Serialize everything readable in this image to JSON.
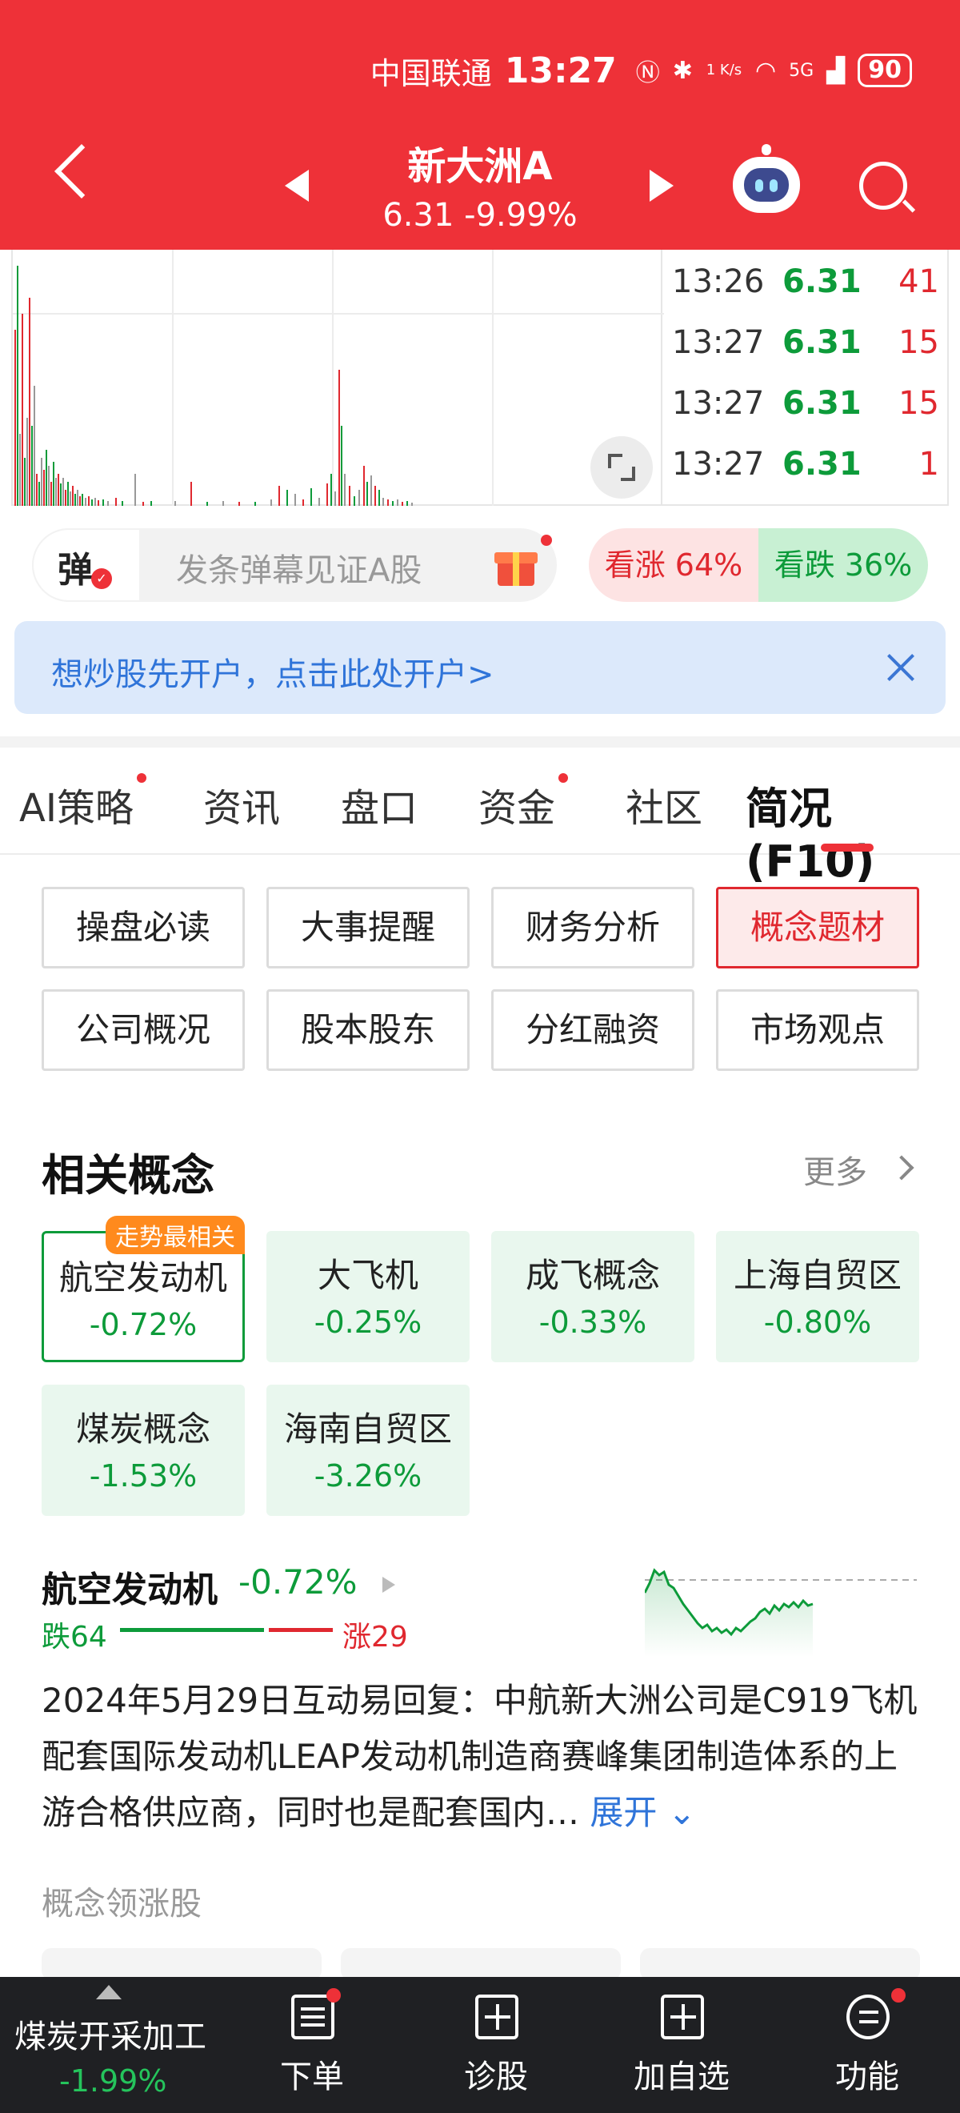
{
  "status_bar": {
    "carrier": "中国联通",
    "time": "13:27",
    "net_speed": "1 K/s",
    "network": "5G",
    "battery": "90"
  },
  "header": {
    "stock_name": "新大洲A",
    "price_line": "6.31 -9.99%",
    "bg_color": "#ee3138"
  },
  "chart": {
    "type": "volume-bars",
    "up_color": "#e0282f",
    "down_color": "#0d9b3a"
  },
  "ticks": [
    {
      "time": "13:26",
      "price": "6.31",
      "vol": "41"
    },
    {
      "time": "13:27",
      "price": "6.31",
      "vol": "15"
    },
    {
      "time": "13:27",
      "price": "6.31",
      "vol": "15"
    },
    {
      "time": "13:27",
      "price": "6.31",
      "vol": "1"
    }
  ],
  "danmaku": {
    "badge": "弹",
    "placeholder": "发条弹幕见证A股"
  },
  "sentiment": {
    "bull": "看涨 64%",
    "bear": "看跌 36%",
    "bull_pct": 64,
    "bear_pct": 36
  },
  "banner": {
    "text": "想炒股先开户，点击此处开户>"
  },
  "tabs": [
    {
      "label": "AI策略",
      "dot": true
    },
    {
      "label": "资讯",
      "dot": false
    },
    {
      "label": "盘口",
      "dot": false
    },
    {
      "label": "资金",
      "dot": true
    },
    {
      "label": "社区",
      "dot": false
    },
    {
      "label": "简况(F10)",
      "dot": false,
      "active": true
    }
  ],
  "f10": [
    {
      "label": "操盘必读"
    },
    {
      "label": "大事提醒"
    },
    {
      "label": "财务分析"
    },
    {
      "label": "概念题材",
      "active": true
    },
    {
      "label": "公司概况"
    },
    {
      "label": "股本股东"
    },
    {
      "label": "分红融资"
    },
    {
      "label": "市场观点"
    }
  ],
  "concepts_section": {
    "title": "相关概念",
    "more": "更多",
    "badge": "走势最相关",
    "items": [
      {
        "name": "航空发动机",
        "pct": "-0.72%"
      },
      {
        "name": "大飞机",
        "pct": "-0.25%"
      },
      {
        "name": "成飞概念",
        "pct": "-0.33%"
      },
      {
        "name": "上海自贸区",
        "pct": "-0.80%"
      },
      {
        "name": "煤炭概念",
        "pct": "-1.53%"
      },
      {
        "name": "海南自贸区",
        "pct": "-3.26%"
      }
    ]
  },
  "concept_detail": {
    "name": "航空发动机",
    "pct": "-0.72%",
    "fall": "跌64",
    "rise": "涨29",
    "fall_count": 64,
    "rise_count": 29,
    "text": "2024年5月29日互动易回复：中航新大洲公司是C919飞机配套国际发动机LEAP发动机制造商赛峰集团制造体系的上游合格供应商，同时也是配套国内…",
    "expand": "展开"
  },
  "leaders": {
    "title": "概念领涨股"
  },
  "bottom_bar": {
    "index_name": "煤炭开采加工",
    "index_pct": "-1.99%",
    "items": [
      {
        "label": "下单",
        "icon": "order-icon",
        "dot": true
      },
      {
        "label": "诊股",
        "icon": "diagnose-icon",
        "dot": false
      },
      {
        "label": "加自选",
        "icon": "add-watchlist-icon",
        "dot": false
      },
      {
        "label": "功能",
        "icon": "menu-icon",
        "dot": true
      }
    ]
  }
}
